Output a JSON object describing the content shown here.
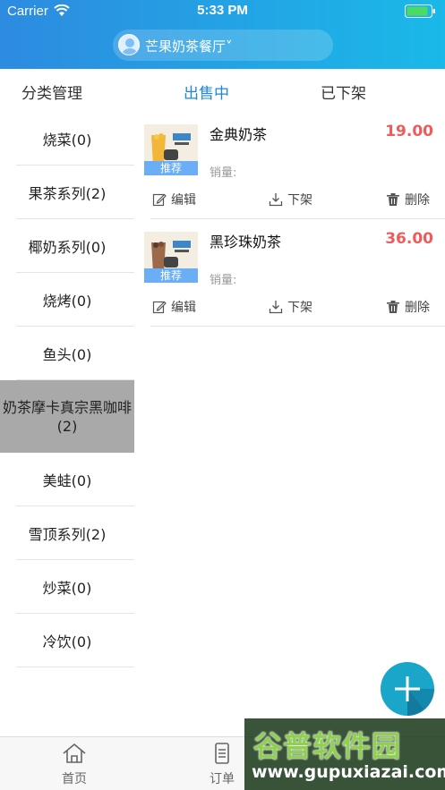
{
  "status_bar": {
    "carrier": "Carrier",
    "time": "5:33 PM"
  },
  "header": {
    "shop_name": "芒果奶茶餐厅",
    "dropdown_glyph": "˅"
  },
  "tabs": [
    {
      "label": "分类管理"
    },
    {
      "label": "出售中",
      "active": true
    },
    {
      "label": "已下架"
    }
  ],
  "categories": [
    {
      "label": "烧菜(0)"
    },
    {
      "label": "果茶系列(2)"
    },
    {
      "label": "椰奶系列(0)"
    },
    {
      "label": "烧烤(0)"
    },
    {
      "label": "鱼头(0)"
    },
    {
      "label": "奶茶摩卡真宗黑咖啡(2)",
      "active": true
    },
    {
      "label": "美蛙(0)"
    },
    {
      "label": "雪顶系列(2)"
    },
    {
      "label": "炒菜(0)"
    },
    {
      "label": "冷饮(0)"
    }
  ],
  "products": [
    {
      "name": "金典奶茶",
      "price": "19.00",
      "badge": "推荐",
      "sales_label": "销量:",
      "edit": "编辑",
      "off_shelf": "下架",
      "delete": "删除"
    },
    {
      "name": "黑珍珠奶茶",
      "price": "36.00",
      "badge": "推荐",
      "sales_label": "销量:",
      "edit": "编辑",
      "off_shelf": "下架",
      "delete": "删除"
    }
  ],
  "tabbar": [
    {
      "label": "首页",
      "icon": "home-icon"
    },
    {
      "label": "订单",
      "icon": "order-icon"
    }
  ],
  "watermark": {
    "title": "谷普软件园",
    "url": "www.gupuxiazai.com"
  },
  "colors": {
    "accent": "#1e88d6",
    "price": "#f05a5a",
    "fab": "#1aa6c9",
    "header_start": "#2d8be0",
    "header_end": "#1ab9e8",
    "active_category": "#a9a9a9"
  }
}
